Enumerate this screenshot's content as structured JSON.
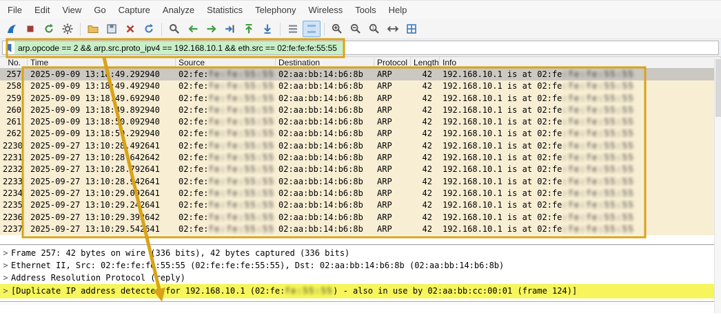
{
  "menu": {
    "items": [
      "File",
      "Edit",
      "View",
      "Go",
      "Capture",
      "Analyze",
      "Statistics",
      "Telephony",
      "Wireless",
      "Tools",
      "Help"
    ]
  },
  "toolbar": {
    "items": [
      "start-capture",
      "stop-capture",
      "restart-capture",
      "capture-options",
      "|",
      "open-capture-file",
      "save-capture-file",
      "close-capture-file",
      "reload-file",
      "|",
      "find-packet",
      "go-back",
      "go-forward",
      "go-to-packet",
      "go-first-packet",
      "go-last-packet",
      "|",
      "auto-scroll",
      "colorize-packets",
      "|",
      "zoom-in",
      "zoom-out",
      "zoom-reset",
      "resize-columns",
      "display-grid"
    ],
    "active": "colorize-packets"
  },
  "filter": {
    "value": "arp.opcode == 2 && arp.src.proto_ipv4 == 192.168.10.1 && eth.src == 02:fe:fe:fe:55:55"
  },
  "packet_list": {
    "columns": [
      "No.",
      "Time",
      "Source",
      "Destination",
      "Protocol",
      "Length",
      "Info"
    ],
    "rows": [
      {
        "no": "257",
        "time": "2025-09-09 13:18:49.292940",
        "source_prefix": "02:fe:",
        "destination": "02:aa:bb:14:b6:8b",
        "protocol": "ARP",
        "length": "42",
        "info_prefix": "192.168.10.1 is at 02:fe",
        "selected": true
      },
      {
        "no": "258",
        "time": "2025-09-09 13:18:49.492940",
        "source_prefix": "02:fe:",
        "destination": "02:aa:bb:14:b6:8b",
        "protocol": "ARP",
        "length": "42",
        "info_prefix": "192.168.10.1 is at 02:fe",
        "selected": false
      },
      {
        "no": "259",
        "time": "2025-09-09 13:18:49.692940",
        "source_prefix": "02:fe:",
        "destination": "02:aa:bb:14:b6:8b",
        "protocol": "ARP",
        "length": "42",
        "info_prefix": "192.168.10.1 is at 02:fe",
        "selected": false
      },
      {
        "no": "260",
        "time": "2025-09-09 13:18:49.892940",
        "source_prefix": "02:fe:",
        "destination": "02:aa:bb:14:b6:8b",
        "protocol": "ARP",
        "length": "42",
        "info_prefix": "192.168.10.1 is at 02:fe",
        "selected": false
      },
      {
        "no": "261",
        "time": "2025-09-09 13:18:50.092940",
        "source_prefix": "02:fe:",
        "destination": "02:aa:bb:14:b6:8b",
        "protocol": "ARP",
        "length": "42",
        "info_prefix": "192.168.10.1 is at 02:fe",
        "selected": false
      },
      {
        "no": "262",
        "time": "2025-09-09 13:18:50.292940",
        "source_prefix": "02:fe:",
        "destination": "02:aa:bb:14:b6:8b",
        "protocol": "ARP",
        "length": "42",
        "info_prefix": "192.168.10.1 is at 02:fe",
        "selected": false
      },
      {
        "no": "2230",
        "time": "2025-09-27 13:10:28.492641",
        "source_prefix": "02:fe:",
        "destination": "02:aa:bb:14:b6:8b",
        "protocol": "ARP",
        "length": "42",
        "info_prefix": "192.168.10.1 is at 02:fe",
        "selected": false
      },
      {
        "no": "2231",
        "time": "2025-09-27 13:10:28.642642",
        "source_prefix": "02:fe:",
        "destination": "02:aa:bb:14:b6:8b",
        "protocol": "ARP",
        "length": "42",
        "info_prefix": "192.168.10.1 is at 02:fe",
        "selected": false
      },
      {
        "no": "2232",
        "time": "2025-09-27 13:10:28.792641",
        "source_prefix": "02:fe:",
        "destination": "02:aa:bb:14:b6:8b",
        "protocol": "ARP",
        "length": "42",
        "info_prefix": "192.168.10.1 is at 02:fe",
        "selected": false
      },
      {
        "no": "2233",
        "time": "2025-09-27 13:10:28.942641",
        "source_prefix": "02:fe:",
        "destination": "02:aa:bb:14:b6:8b",
        "protocol": "ARP",
        "length": "42",
        "info_prefix": "192.168.10.1 is at 02:fe",
        "selected": false
      },
      {
        "no": "2234",
        "time": "2025-09-27 13:10:29.092641",
        "source_prefix": "02:fe:",
        "destination": "02:aa:bb:14:b6:8b",
        "protocol": "ARP",
        "length": "42",
        "info_prefix": "192.168.10.1 is at 02:fe",
        "selected": false
      },
      {
        "no": "2235",
        "time": "2025-09-27 13:10:29.242641",
        "source_prefix": "02:fe:",
        "destination": "02:aa:bb:14:b6:8b",
        "protocol": "ARP",
        "length": "42",
        "info_prefix": "192.168.10.1 is at 02:fe",
        "selected": false
      },
      {
        "no": "2236",
        "time": "2025-09-27 13:10:29.392642",
        "source_prefix": "02:fe:",
        "destination": "02:aa:bb:14:b6:8b",
        "protocol": "ARP",
        "length": "42",
        "info_prefix": "192.168.10.1 is at 02:fe",
        "selected": false
      },
      {
        "no": "2237",
        "time": "2025-09-27 13:10:29.542641",
        "source_prefix": "02:fe:",
        "destination": "02:aa:bb:14:b6:8b",
        "protocol": "ARP",
        "length": "42",
        "info_prefix": "192.168.10.1 is at 02:fe",
        "selected": false
      }
    ]
  },
  "details": {
    "expander_glyph": ">",
    "lines": [
      "Frame 257: 42 bytes on wire (336 bits), 42 bytes captured (336 bits)",
      "Ethernet II, Src: 02:fe:fe:fe:55:55 (02:fe:fe:fe:55:55), Dst: 02:aa:bb:14:b6:8b (02:aa:bb:14:b6:8b)",
      "Address Resolution Protocol (reply)"
    ],
    "duplicate": {
      "prefix": "[Duplicate IP address detected for 192.168.10.1 (02:fe:",
      "suffix": ") - also in use by 02:aa:bb:cc:00:01 (frame 124)]"
    }
  },
  "redaction": {
    "source_fill": "fe:fe:55:55",
    "info_fill": ":fe:fe:55:55",
    "detail_fill": "fe:55:55"
  },
  "colors": {
    "annotation": "#d8a317",
    "filter_valid_bg": "#c9efc9",
    "arp_row_bg": "#f8eed4",
    "selected_row_bg": "#cbc8c1",
    "warning_row_bg": "#f6f65c"
  }
}
